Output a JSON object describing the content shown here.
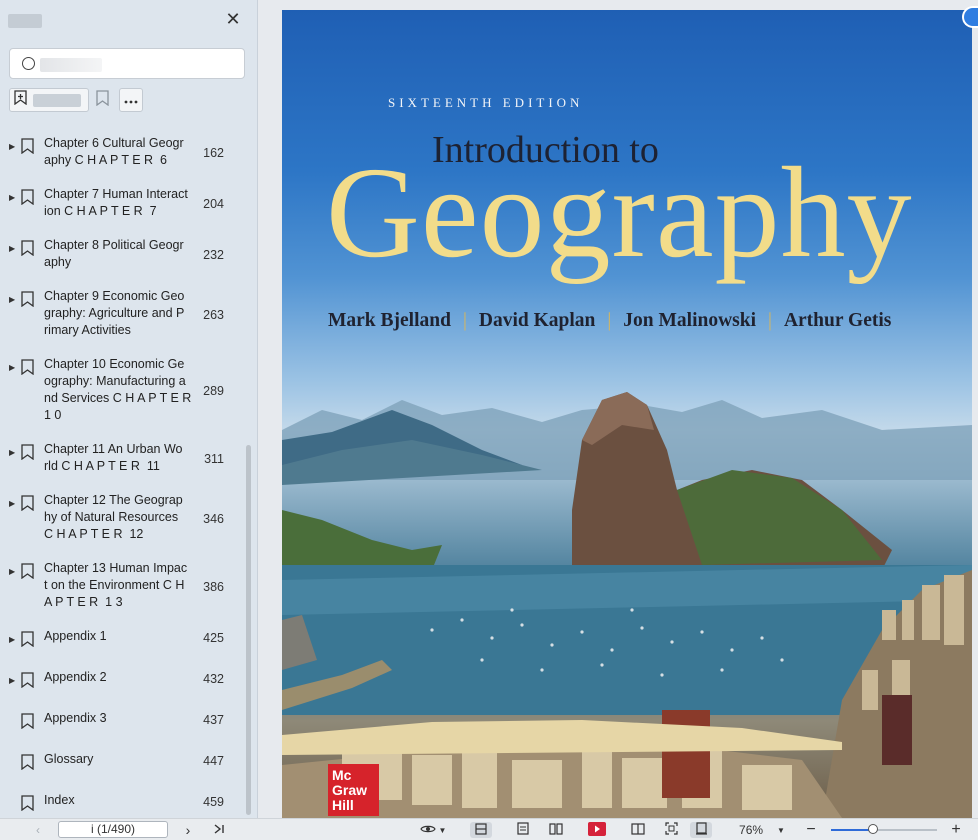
{
  "sidebar": {
    "close_label": "✕",
    "toc": [
      {
        "label": "Chapter 6 Cultural Geography CHAPTER 6",
        "page": "162",
        "expandable": true,
        "lines": [
          "Chapter 6 Cultural Geogr",
          "aphy C H A P T E R  6"
        ]
      },
      {
        "label": "Chapter 7 Human Interaction CHAPTER 7",
        "page": "204",
        "expandable": true,
        "lines": [
          "Chapter 7 Human Interact",
          "ion C H A P T E R  7"
        ]
      },
      {
        "label": "Chapter 8 Political Geography",
        "page": "232",
        "expandable": true,
        "lines": [
          "Chapter 8 Political Geogr",
          "aphy"
        ]
      },
      {
        "label": "Chapter 9 Economic Geography: Agriculture and Primary Activities",
        "page": "263",
        "expandable": true,
        "lines": [
          "Chapter 9 Economic Geo",
          "graphy: Agriculture and P",
          "rimary Activities"
        ]
      },
      {
        "label": "Chapter 10 Economic Geography: Manufacturing and Services CHAPTER 10",
        "page": "289",
        "expandable": true,
        "lines": [
          "Chapter 10 Economic Ge",
          "ography: Manufacturing a",
          "nd Services C H A P T E R",
          "1 0"
        ]
      },
      {
        "label": "Chapter 11 An Urban World CHAPTER 11",
        "page": "311",
        "expandable": true,
        "lines": [
          "Chapter 11 An Urban Wo",
          "rld C H A P T E R  11"
        ]
      },
      {
        "label": "Chapter 12 The Geography of Natural Resources CHAPTER 12",
        "page": "346",
        "expandable": true,
        "lines": [
          "Chapter 12 The Geograp",
          "hy of Natural Resources",
          "C H A P T E R  12"
        ]
      },
      {
        "label": "Chapter 13 Human Impact on the Environment CHAPTER 13",
        "page": "386",
        "expandable": true,
        "lines": [
          "Chapter 13 Human Impac",
          "t on the Environment C H",
          "A P T E R  1 3"
        ]
      },
      {
        "label": "Appendix 1",
        "page": "425",
        "expandable": true,
        "lines": [
          "Appendix 1"
        ]
      },
      {
        "label": "Appendix 2",
        "page": "432",
        "expandable": true,
        "lines": [
          "Appendix 2"
        ]
      },
      {
        "label": "Appendix 3",
        "page": "437",
        "expandable": false,
        "lines": [
          "Appendix 3"
        ]
      },
      {
        "label": "Glossary",
        "page": "447",
        "expandable": false,
        "lines": [
          "Glossary"
        ]
      },
      {
        "label": "Index",
        "page": "459",
        "expandable": false,
        "lines": [
          "Index"
        ]
      }
    ]
  },
  "cover": {
    "edition": "SIXTEENTH EDITION",
    "intro": "Introduction to",
    "title": "Geography",
    "authors": [
      "Mark Bjelland",
      "David Kaplan",
      "Jon Malinowski",
      "Arthur Getis"
    ],
    "separator": "|",
    "publisher_logo_lines": [
      "Mc",
      "Graw",
      "Hill"
    ]
  },
  "statusbar": {
    "page_indicator": "i (1/490)",
    "zoom_level": "76%",
    "zoom_fraction": 0.4
  }
}
